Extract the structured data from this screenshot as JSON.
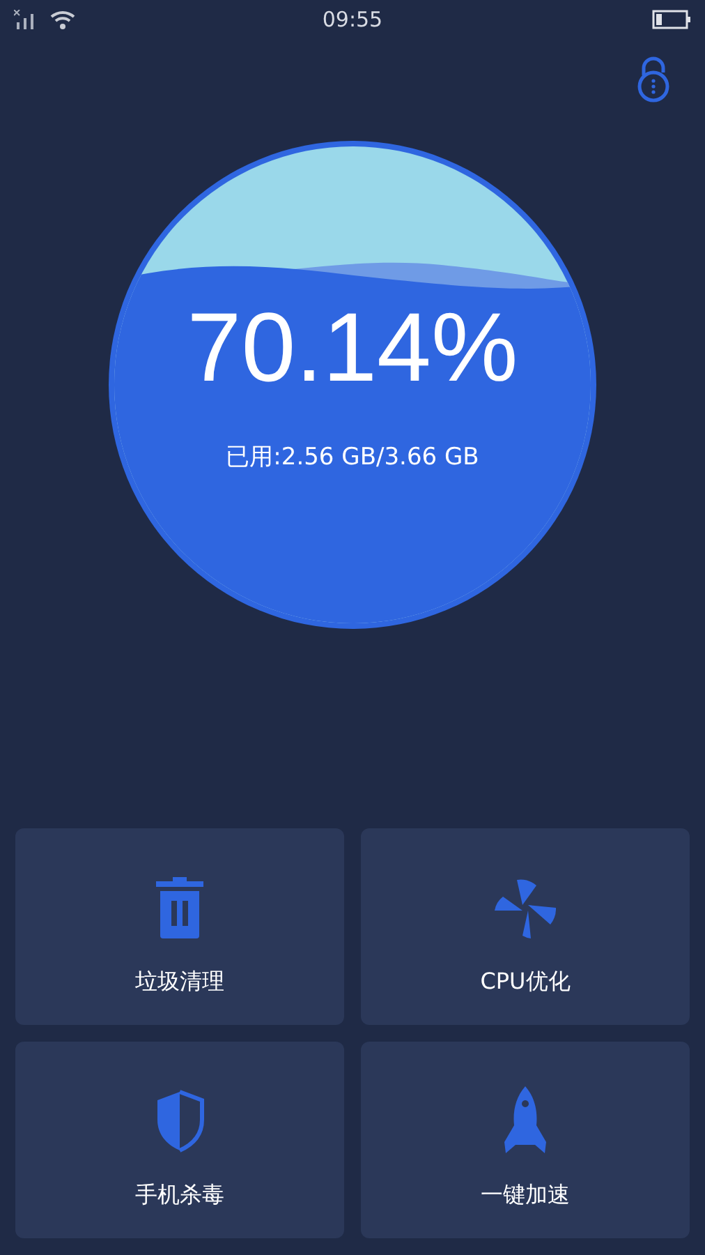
{
  "status_bar": {
    "time": "09:55"
  },
  "memory": {
    "percent": "70.14%",
    "usage": "已用:2.56 GB/3.66 GB"
  },
  "tools": [
    {
      "kind": "trash",
      "label": "垃圾清理"
    },
    {
      "kind": "fan",
      "label": "CPU优化"
    },
    {
      "kind": "shield",
      "label": "手机杀毒"
    },
    {
      "kind": "rocket",
      "label": "一键加速"
    }
  ]
}
